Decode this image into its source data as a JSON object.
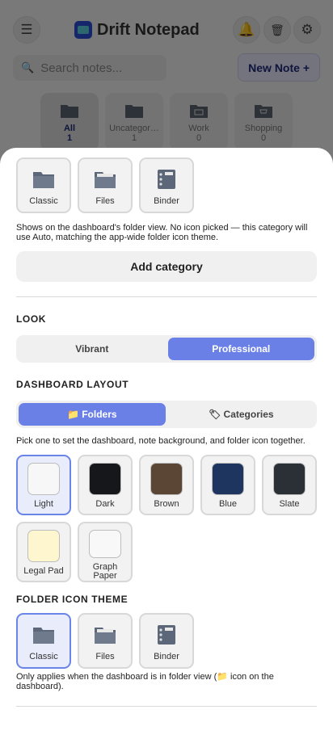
{
  "app": {
    "title": "Drift Notepad",
    "menu_icon": "☰",
    "bell_icon": "🔔",
    "trash_icon": "🗑",
    "gear_icon": "⚙",
    "search_placeholder": "Search notes...",
    "new_note_label": "New Note +",
    "categories": [
      {
        "name": "All",
        "count": "1",
        "active": true
      },
      {
        "name": "Uncategor…",
        "count": "1"
      },
      {
        "name": "Work",
        "count": "0"
      },
      {
        "name": "Shopping",
        "count": "0"
      }
    ]
  },
  "sheet": {
    "category_icon_options": [
      {
        "label": "Classic",
        "icon": "folder-classic-icon"
      },
      {
        "label": "Files",
        "icon": "folder-files-icon"
      },
      {
        "label": "Binder",
        "icon": "binder-icon"
      }
    ],
    "category_icon_help": "Shows on the dashboard's folder view. No icon picked — this category will use Auto, matching the app-wide folder icon theme.",
    "add_category_label": "Add category",
    "look": {
      "title": "LOOK",
      "options": [
        "Vibrant",
        "Professional"
      ],
      "selected": "Professional"
    },
    "layout": {
      "title": "DASHBOARD LAYOUT",
      "options": [
        "📁 Folders",
        "🏷 Categories"
      ],
      "selected": "📁 Folders",
      "help": "Pick one to set the dashboard, note background, and folder icon together."
    },
    "themes": [
      {
        "label": "Light",
        "color": "#f7f7f7",
        "selected": true
      },
      {
        "label": "Dark",
        "color": "#16171b"
      },
      {
        "label": "Brown",
        "color": "#5b4535"
      },
      {
        "label": "Blue",
        "color": "#1e3560"
      },
      {
        "label": "Slate",
        "color": "#2b2f36"
      },
      {
        "label": "Legal Pad",
        "color": "#fdf6cf"
      },
      {
        "label": "Graph Paper",
        "color": "#f8f8f8"
      }
    ],
    "folder_icon_theme": {
      "title": "FOLDER ICON THEME",
      "options": [
        {
          "label": "Classic",
          "icon": "folder-classic-icon",
          "selected": true
        },
        {
          "label": "Files",
          "icon": "folder-files-icon"
        },
        {
          "label": "Binder",
          "icon": "binder-icon"
        }
      ],
      "help": "Only applies when the dashboard is in folder view (📁 icon on the dashboard)."
    }
  },
  "colors": {
    "accent": "#6a80e6",
    "selected_border": "#6a85e8",
    "new_note_text": "#1e2a78"
  }
}
